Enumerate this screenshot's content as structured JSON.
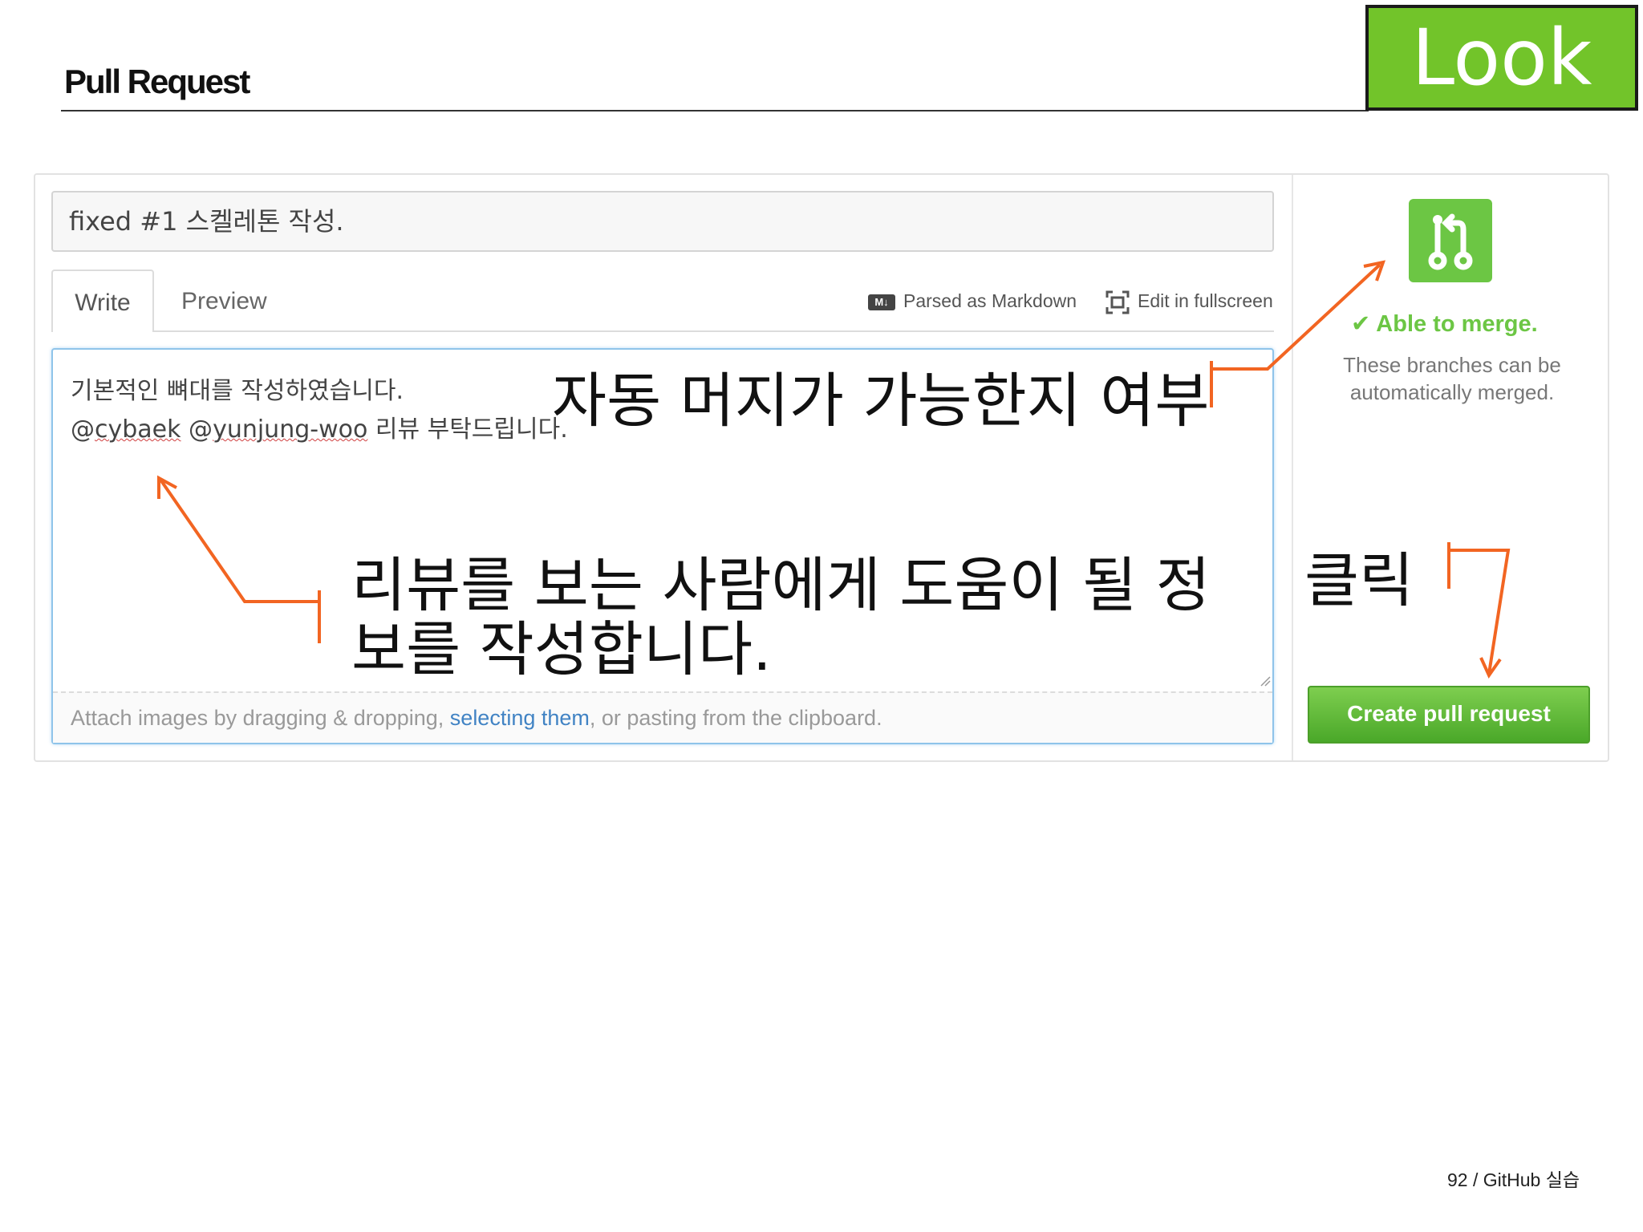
{
  "slide": {
    "title": "Pull Request",
    "badge": "Look",
    "footer": "92 / GitHub 실습"
  },
  "pr_form": {
    "title_value": "fixed #1 스켈레톤 작성.",
    "tabs": [
      {
        "label": "Write",
        "selected": true
      },
      {
        "label": "Preview",
        "selected": false
      }
    ],
    "markdown_label": "Parsed as Markdown",
    "markdown_icon": "markdown-icon",
    "fullscreen_label": "Edit in fullscreen",
    "fullscreen_icon": "fullscreen-icon",
    "body_lines": [
      "기본적인 뼈대를 작성하였습니다.",
      "@cybaek @yunjung-woo 리뷰 부탁드립니다."
    ],
    "attach": {
      "before": "Attach images by dragging & dropping, ",
      "link": "selecting them",
      "after": ", or pasting from the clipboard."
    }
  },
  "merge_status": {
    "icon": "git-pull-request-icon",
    "check_icon": "check-icon",
    "title": "Able to merge.",
    "description": "These branches can be automatically merged.",
    "button_label": "Create pull request"
  },
  "annotations": {
    "merge": "자동 머지가 가능한지 여부",
    "review": "리뷰를 보는 사람에게 도움이 될 정보를 작성합니다.",
    "click": "클릭",
    "color": "#f26522"
  },
  "colors": {
    "badge_green": "#72c42a",
    "merge_green": "#6cc644",
    "link_blue": "#4183c4",
    "focus_blue": "#8fc4ea"
  }
}
